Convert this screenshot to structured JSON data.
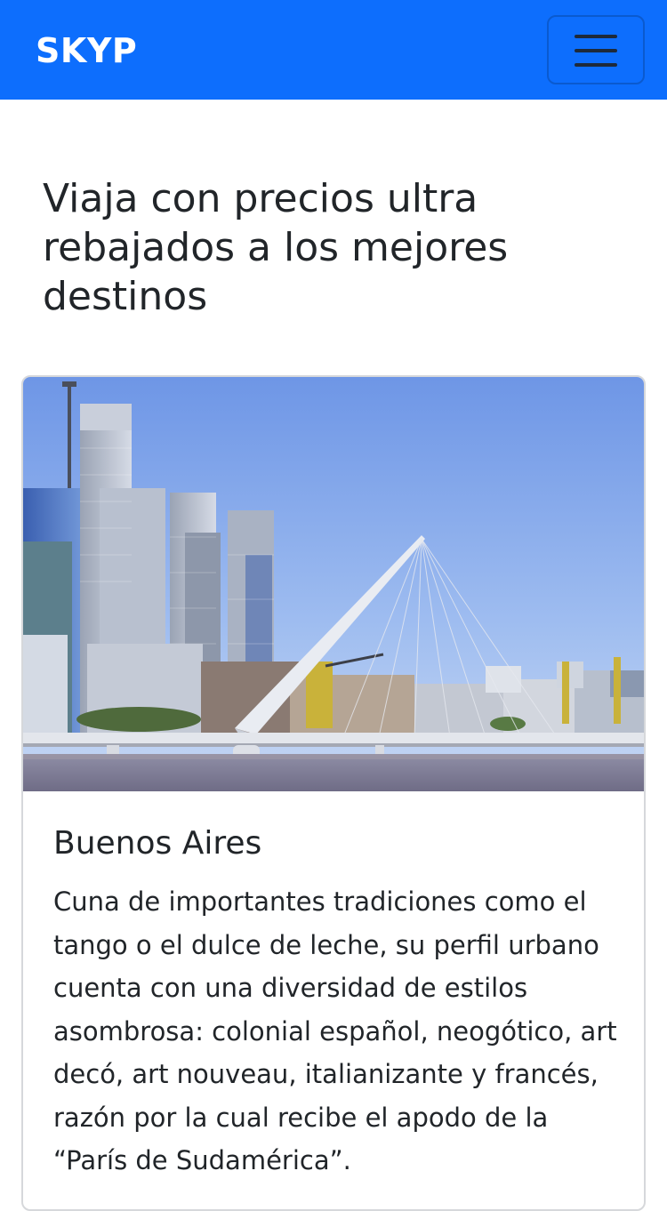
{
  "navbar": {
    "brand": "SKYP",
    "toggle_icon": "hamburger-menu-icon",
    "background_color": "#0d6efd"
  },
  "main": {
    "heading": "Viaja con precios ultra rebajados a los mejores destinos"
  },
  "card": {
    "image_subject": "Buenos Aires skyline with Puente de la Mujer bridge",
    "title": "Buenos Aires",
    "text": "Cuna de importantes tradiciones como el tango o el dulce de leche, su perfil urbano cuenta con una diversidad de estilos asombrosa: colonial español, neogótico, art decó, art nouveau, italianizante y francés, razón por la cual recibe el apodo de la “París de Sudamérica”."
  }
}
